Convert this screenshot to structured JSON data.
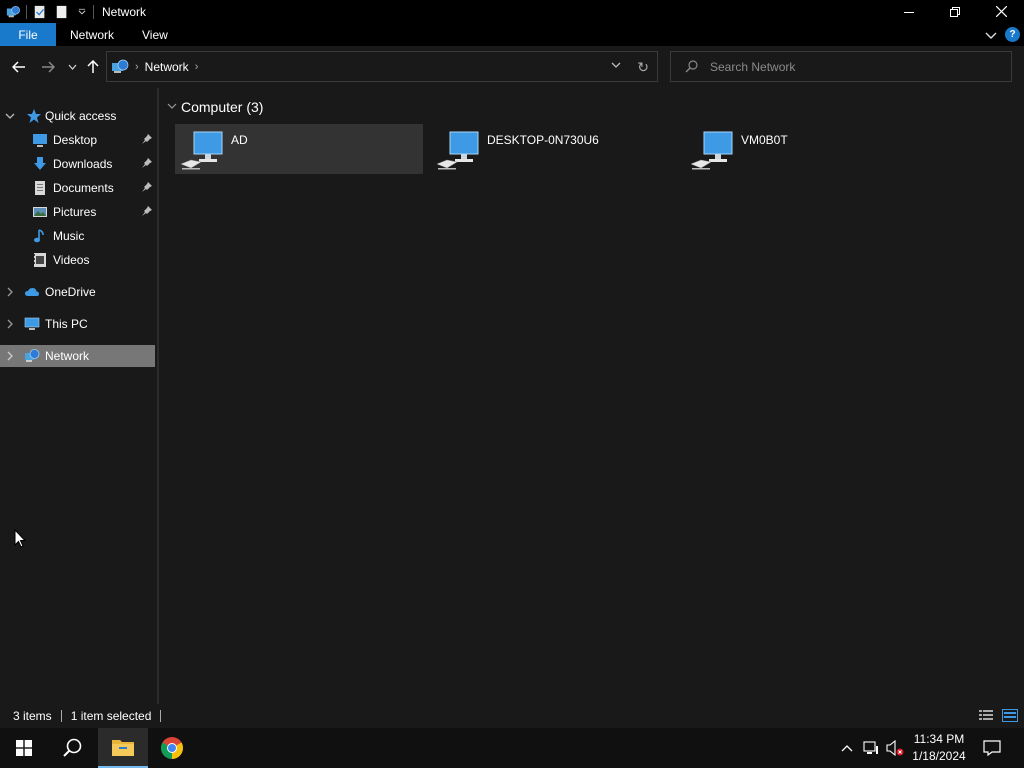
{
  "window": {
    "title": "Network"
  },
  "ribbon": {
    "tabs": [
      "File",
      "Network",
      "View"
    ]
  },
  "address": {
    "crumbs": [
      "Network"
    ]
  },
  "search": {
    "placeholder": "Search Network"
  },
  "nav": {
    "quick_access": "Quick access",
    "items": [
      {
        "label": "Desktop",
        "icon": "desktop-icon",
        "pinned": true
      },
      {
        "label": "Downloads",
        "icon": "downloads-icon",
        "pinned": true
      },
      {
        "label": "Documents",
        "icon": "documents-icon",
        "pinned": true
      },
      {
        "label": "Pictures",
        "icon": "pictures-icon",
        "pinned": true
      },
      {
        "label": "Music",
        "icon": "music-icon",
        "pinned": false
      },
      {
        "label": "Videos",
        "icon": "videos-icon",
        "pinned": false
      }
    ],
    "onedrive": "OneDrive",
    "this_pc": "This PC",
    "network": "Network",
    "selected": "Network"
  },
  "content": {
    "group_header": "Computer (3)",
    "computers": [
      {
        "name": "AD",
        "selected": true
      },
      {
        "name": "DESKTOP-0N730U6",
        "selected": false
      },
      {
        "name": "VM0B0T",
        "selected": false
      }
    ]
  },
  "status": {
    "items": "3 items",
    "selection": "1 item selected"
  },
  "taskbar": {
    "time": "11:34 PM",
    "date": "1/18/2024"
  },
  "colors": {
    "accent": "#1979ca",
    "background": "#191919",
    "selection": "#777777"
  }
}
